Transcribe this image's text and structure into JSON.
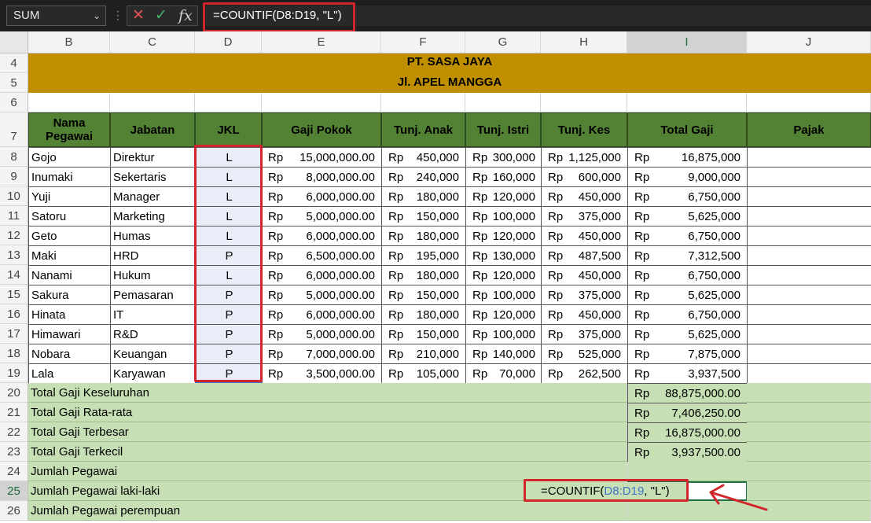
{
  "namebox": "SUM",
  "formula": "=COUNTIF(D8:D19, \"L\")",
  "columns": [
    "B",
    "C",
    "D",
    "E",
    "F",
    "G",
    "H",
    "I",
    "J"
  ],
  "rows": [
    "4",
    "5",
    "6",
    "7",
    "8",
    "9",
    "10",
    "11",
    "12",
    "13",
    "14",
    "15",
    "16",
    "17",
    "18",
    "19",
    "20",
    "21",
    "22",
    "23",
    "24",
    "25",
    "26"
  ],
  "title1": "PT. SASA JAYA",
  "title2": "Jl. APEL MANGGA",
  "headers": {
    "nama": "Nama Pegawai",
    "jabatan": "Jabatan",
    "jkl": "JKL",
    "gaji_pokok": "Gaji Pokok",
    "tunj_anak": "Tunj. Anak",
    "tunj_istri": "Tunj. Istri",
    "tunj_kes": "Tunj. Kes",
    "total_gaji": "Total Gaji",
    "pajak": "Pajak"
  },
  "currency": "Rp",
  "employees": [
    {
      "nama": "Gojo",
      "jabatan": "Direktur",
      "jkl": "L",
      "gaji": "15,000,000.00",
      "anak": "450,000",
      "istri": "300,000",
      "kes": "1,125,000",
      "total": "16,875,000"
    },
    {
      "nama": "Inumaki",
      "jabatan": "Sekertaris",
      "jkl": "L",
      "gaji": "8,000,000.00",
      "anak": "240,000",
      "istri": "160,000",
      "kes": "600,000",
      "total": "9,000,000"
    },
    {
      "nama": "Yuji",
      "jabatan": "Manager",
      "jkl": "L",
      "gaji": "6,000,000.00",
      "anak": "180,000",
      "istri": "120,000",
      "kes": "450,000",
      "total": "6,750,000"
    },
    {
      "nama": "Satoru",
      "jabatan": "Marketing",
      "jkl": "L",
      "gaji": "5,000,000.00",
      "anak": "150,000",
      "istri": "100,000",
      "kes": "375,000",
      "total": "5,625,000"
    },
    {
      "nama": "Geto",
      "jabatan": "Humas",
      "jkl": "L",
      "gaji": "6,000,000.00",
      "anak": "180,000",
      "istri": "120,000",
      "kes": "450,000",
      "total": "6,750,000"
    },
    {
      "nama": "Maki",
      "jabatan": "HRD",
      "jkl": "P",
      "gaji": "6,500,000.00",
      "anak": "195,000",
      "istri": "130,000",
      "kes": "487,500",
      "total": "7,312,500"
    },
    {
      "nama": "Nanami",
      "jabatan": "Hukum",
      "jkl": "L",
      "gaji": "6,000,000.00",
      "anak": "180,000",
      "istri": "120,000",
      "kes": "450,000",
      "total": "6,750,000"
    },
    {
      "nama": "Sakura",
      "jabatan": "Pemasaran",
      "jkl": "P",
      "gaji": "5,000,000.00",
      "anak": "150,000",
      "istri": "100,000",
      "kes": "375,000",
      "total": "5,625,000"
    },
    {
      "nama": "Hinata",
      "jabatan": "IT",
      "jkl": "P",
      "gaji": "6,000,000.00",
      "anak": "180,000",
      "istri": "120,000",
      "kes": "450,000",
      "total": "6,750,000"
    },
    {
      "nama": "Himawari",
      "jabatan": "R&D",
      "jkl": "P",
      "gaji": "5,000,000.00",
      "anak": "150,000",
      "istri": "100,000",
      "kes": "375,000",
      "total": "5,625,000"
    },
    {
      "nama": "Nobara",
      "jabatan": "Keuangan",
      "jkl": "P",
      "gaji": "7,000,000.00",
      "anak": "210,000",
      "istri": "140,000",
      "kes": "525,000",
      "total": "7,875,000"
    },
    {
      "nama": "Lala",
      "jabatan": "Karyawan",
      "jkl": "P",
      "gaji": "3,500,000.00",
      "anak": "105,000",
      "istri": "70,000",
      "kes": "262,500",
      "total": "3,937,500"
    }
  ],
  "summary": [
    {
      "label": "Total Gaji Keseluruhan",
      "value": "88,875,000.00"
    },
    {
      "label": "Total Gaji Rata-rata",
      "value": "7,406,250.00"
    },
    {
      "label": "Total Gaji Terbesar",
      "value": "16,875,000.00"
    },
    {
      "label": "Total Gaji Terkecil",
      "value": "3,937,500.00"
    },
    {
      "label": "Jumlah Pegawai",
      "value": ""
    },
    {
      "label": "Jumlah Pegawai laki-laki",
      "value": ""
    },
    {
      "label": "Jumlah Pegawai perempuan",
      "value": ""
    }
  ],
  "edit_formula": {
    "prefix": "=COUNTIF(",
    "ref": "D8:D19",
    "suffix": ", \"L\")"
  },
  "colors": {
    "banner": "#bf8f00",
    "header": "#548235",
    "summary": "#c6dfb4",
    "highlight": "#d1262b",
    "ref": "#4472c4"
  }
}
